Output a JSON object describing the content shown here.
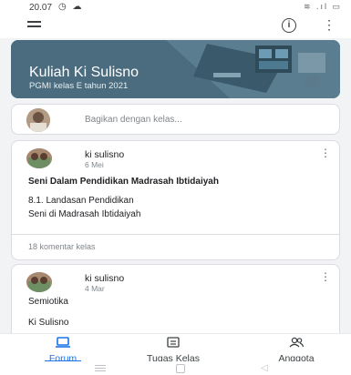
{
  "status_bar": {
    "time": "20.07",
    "left_icons": "◷ ☁",
    "right_icons": "≋ .ıl ▭"
  },
  "app_bar": {
    "info_glyph": "i",
    "kebab_glyph": "⋮"
  },
  "banner": {
    "title": "Kuliah Ki Sulisno",
    "subtitle": "PGMI kelas E tahun 2021",
    "color": "#4a6c7e"
  },
  "share": {
    "placeholder": "Bagikan dengan kelas..."
  },
  "posts": [
    {
      "author": "ki sulisno",
      "date": "6 Mei",
      "title": "Seni Dalam Pendidikan Madrasah Ibtidaiyah",
      "body_line1": "8.1. Landasan Pendidikan",
      "body_line2": "Seni di Madrasah Ibtidaiyah",
      "comments": "18 komentar kelas"
    },
    {
      "author": "ki sulisno",
      "date": "4 Mar",
      "line1": "Semiotika",
      "line2": "Ki Sulisno"
    }
  ],
  "bottom_nav": {
    "items": [
      {
        "label": "Forum",
        "icon": "forum-icon",
        "active": true
      },
      {
        "label": "Tugas Kelas",
        "icon": "classwork-icon",
        "active": false
      },
      {
        "label": "Anggota",
        "icon": "people-icon",
        "active": false
      }
    ],
    "accent": "#1a73e8"
  },
  "system_nav": {
    "back_glyph": "◁"
  }
}
